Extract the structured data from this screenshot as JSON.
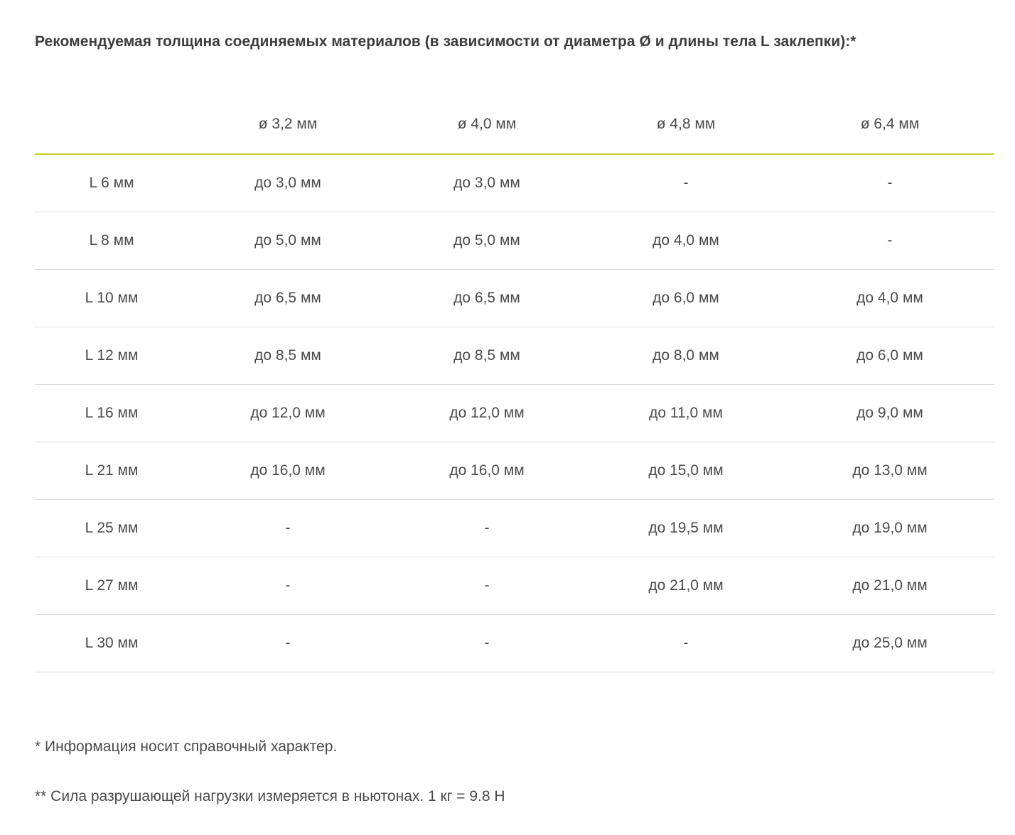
{
  "heading": "Рекомендуемая толщина соединяемых материалов (в зависимости от диаметра Ø и длины тела L заклепки):*",
  "table": {
    "headers": [
      "",
      "ø 3,2 мм",
      "ø 4,0 мм",
      "ø 4,8 мм",
      "ø 6,4 мм"
    ],
    "rows": [
      [
        "L 6 мм",
        "до 3,0 мм",
        "до 3,0 мм",
        "-",
        "-"
      ],
      [
        "L 8 мм",
        "до 5,0 мм",
        "до 5,0 мм",
        "до 4,0 мм",
        "-"
      ],
      [
        "L 10 мм",
        "до 6,5 мм",
        "до 6,5 мм",
        "до 6,0 мм",
        "до 4,0 мм"
      ],
      [
        "L 12 мм",
        "до 8,5 мм",
        "до 8,5 мм",
        "до 8,0 мм",
        "до 6,0 мм"
      ],
      [
        "L 16 мм",
        "до 12,0 мм",
        "до 12,0 мм",
        "до 11,0 мм",
        "до 9,0 мм"
      ],
      [
        "L 21 мм",
        "до 16,0 мм",
        "до 16,0 мм",
        "до 15,0 мм",
        "до 13,0 мм"
      ],
      [
        "L 25 мм",
        "-",
        "-",
        "до 19,5 мм",
        "до 19,0 мм"
      ],
      [
        "L 27 мм",
        "-",
        "-",
        "до 21,0 мм",
        "до 21,0 мм"
      ],
      [
        "L 30 мм",
        "-",
        "-",
        "-",
        "до 25,0 мм"
      ]
    ]
  },
  "notes": {
    "reference": "* Информация носит справочный характер.",
    "force": "** Сила разрушающей нагрузки измеряется в ньютонах. 1 кг = 9.8 Н"
  },
  "colors": {
    "header_rule": "#c8cd2a",
    "row_rule": "#dcdcdc",
    "text": "#4a4a4a"
  }
}
